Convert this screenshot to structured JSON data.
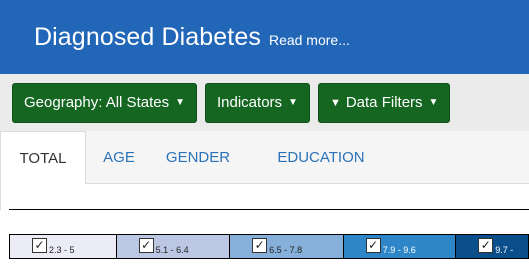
{
  "header": {
    "title": "Diagnosed Diabetes",
    "read_more": "Read more..."
  },
  "toolbar": {
    "geography_label": "Geography: All States",
    "indicators_label": "Indicators",
    "filters_label": "Data Filters"
  },
  "tabs": [
    {
      "label": "TOTAL",
      "active": true
    },
    {
      "label": "AGE",
      "active": false
    },
    {
      "label": "GENDER",
      "active": false
    },
    {
      "label": "EDUCATION",
      "active": false
    }
  ],
  "legend": {
    "items": [
      {
        "range": "2.3 - 5",
        "color": "#ececf7",
        "checked": true
      },
      {
        "range": "5.1 - 6.4",
        "color": "#bcc8e3",
        "checked": true
      },
      {
        "range": "6.5 - 7.8",
        "color": "#86b0d9",
        "checked": true
      },
      {
        "range": "7.9 - 9.6",
        "color": "#2e86c9",
        "checked": true
      },
      {
        "range": "9.7 -",
        "color": "#0a4f8c",
        "checked": true
      }
    ]
  },
  "colors": {
    "header_bg": "#2266b8",
    "button_bg": "#146621",
    "tab_link": "#2a73b8"
  }
}
